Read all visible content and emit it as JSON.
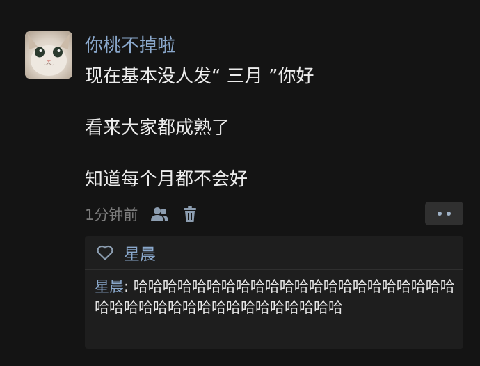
{
  "post": {
    "username": "你桃不掉啦",
    "lines": [
      "现在基本没人发“ 三月 ”你好",
      "看来大家都成熟了",
      "知道每个月都不会好"
    ],
    "timestamp": "1分钟前"
  },
  "icons": {
    "avatar": "cat-avatar",
    "friends": "people-icon",
    "delete": "trash-icon",
    "more": "more-dots-icon",
    "like": "heart-icon"
  },
  "reply_section": {
    "like_user": "星晨",
    "reply": {
      "author": "星晨",
      "separator": ": ",
      "text": "哈哈哈哈哈哈哈哈哈哈哈哈哈哈哈哈哈哈哈哈哈哈哈哈哈哈哈哈哈哈哈哈哈哈哈哈哈哈哈"
    }
  },
  "colors": {
    "background": "#141414",
    "username": "#8aa8cc",
    "text": "#ececec",
    "muted": "#7b7b7b",
    "reply_bg": "#1e1e1e"
  }
}
